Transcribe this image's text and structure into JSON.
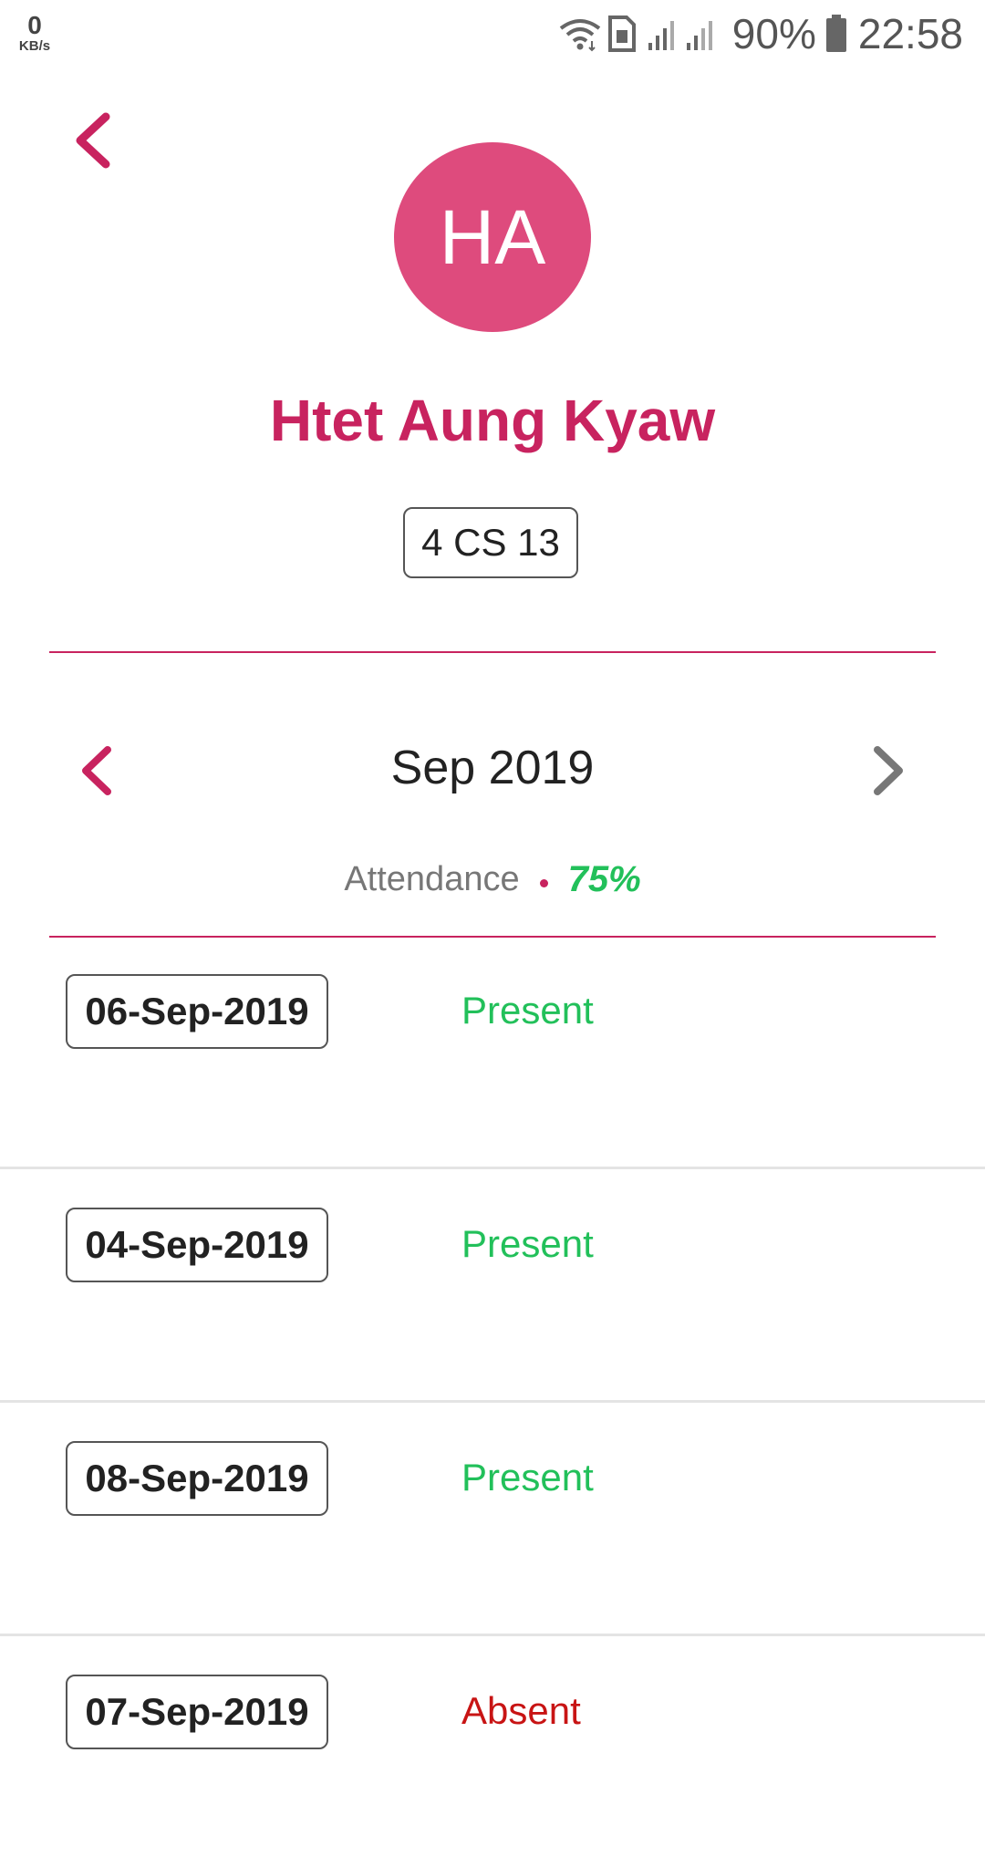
{
  "status_bar": {
    "net_speed_value": "0",
    "net_speed_unit": "KB/s",
    "battery": "90%",
    "time": "22:58",
    "icons": [
      "wifi-icon",
      "sim-icon",
      "signal-icon",
      "battery-icon"
    ]
  },
  "profile": {
    "initials": "HA",
    "name": "Htet Aung Kyaw",
    "class_code": "4 CS 13"
  },
  "month_nav": {
    "label": "Sep 2019",
    "prev_icon": "chevron-left-icon",
    "next_icon": "chevron-right-icon"
  },
  "attendance": {
    "label": "Attendance",
    "value": "75%"
  },
  "records": [
    {
      "date": "06-Sep-2019",
      "status": "Present"
    },
    {
      "date": "04-Sep-2019",
      "status": "Present"
    },
    {
      "date": "08-Sep-2019",
      "status": "Present"
    },
    {
      "date": "07-Sep-2019",
      "status": "Absent"
    }
  ],
  "colors": {
    "accent": "#c8235f",
    "avatar": "#de4b7d",
    "present": "#22c05a",
    "absent": "#c81414"
  }
}
